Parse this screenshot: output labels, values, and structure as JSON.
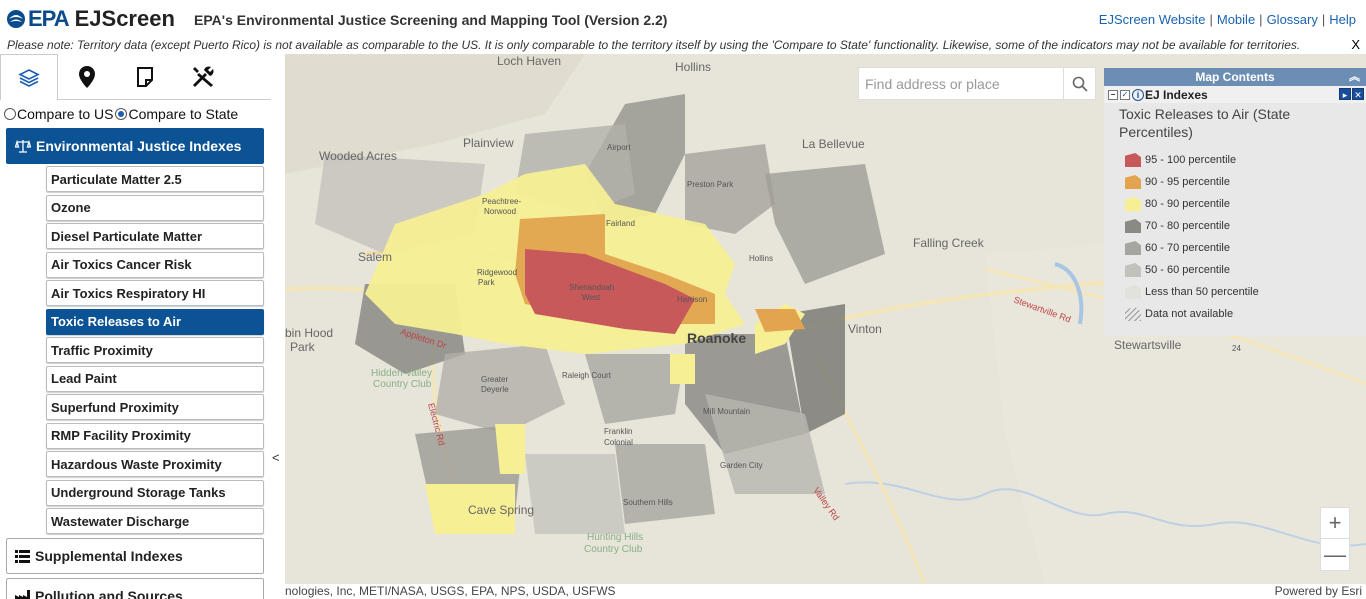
{
  "header": {
    "logo_text": "EPA",
    "app_name": "EJScreen",
    "subtitle": "EPA's Environmental Justice Screening and Mapping Tool (Version 2.2)",
    "links": [
      "EJScreen Website",
      "Mobile",
      "Glossary",
      "Help"
    ]
  },
  "notice": {
    "text": "Please note: Territory data (except Puerto Rico) is not available as comparable to the US. It is only comparable to the territory itself by using the 'Compare to State' functionality. Likewise, some of the indicators may not be available for territories.",
    "close": "X"
  },
  "tabs": [
    "layers-icon",
    "location-pin-icon",
    "report-icon",
    "tools-icon"
  ],
  "compare": {
    "us_label": "Compare to US",
    "state_label": "Compare to State",
    "selected": "state"
  },
  "groups": {
    "ej": "Environmental Justice Indexes",
    "supplemental": "Supplemental Indexes",
    "pollution": "Pollution and Sources"
  },
  "ej_items": [
    "Particulate Matter 2.5",
    "Ozone",
    "Diesel Particulate Matter",
    "Air Toxics Cancer Risk",
    "Air Toxics Respiratory HI",
    "Toxic Releases to Air",
    "Traffic Proximity",
    "Lead Paint",
    "Superfund Proximity",
    "RMP Facility Proximity",
    "Hazardous Waste Proximity",
    "Underground Storage Tanks",
    "Wastewater Discharge"
  ],
  "active_item": "Toxic Releases to Air",
  "collapse_glyph": "<",
  "search": {
    "placeholder": "Find address or place"
  },
  "map_contents": {
    "title": "Map Contents",
    "layer": "EJ Indexes",
    "sublayer": "Toxic Releases to Air (State Percentiles)",
    "legend": [
      {
        "label": "95 - 100 percentile",
        "color": "#c8595a"
      },
      {
        "label": "90 - 95 percentile",
        "color": "#e2a44e"
      },
      {
        "label": "80 - 90 percentile",
        "color": "#f6ef94"
      },
      {
        "label": "70 - 80 percentile",
        "color": "#8a8a84"
      },
      {
        "label": "60 - 70 percentile",
        "color": "#a6a6a0"
      },
      {
        "label": "50 - 60 percentile",
        "color": "#c2c2bc"
      },
      {
        "label": "Less than 50 percentile",
        "color": "#e2e2dc"
      },
      {
        "label": "Data not available",
        "color": "hatch"
      }
    ]
  },
  "map_labels": {
    "loch_haven": "Loch Haven",
    "hollins_n": "Hollins",
    "plainview": "Plainview",
    "airport": "Airport",
    "la_bellevue": "La Bellevue",
    "wooded_acres": "Wooded Acres",
    "preston_park": "Preston Park",
    "peachtree": "Peachtree-",
    "norwood": "Norwood",
    "fairland": "Fairland",
    "falling_creek": "Falling Creek",
    "salem": "Salem",
    "ridgewood": "Ridgewood",
    "park": "Park",
    "shenandoah": "Shenandoah",
    "west": "West",
    "hollins_e": "Hollins",
    "harrison": "Harrison",
    "roanoke": "Roanoke",
    "vinton": "Vinton",
    "stewartsville": "Stewartsville",
    "robin_hood": "bin Hood",
    "robin_park": "Park",
    "appleton": "Appleton Dr",
    "hidden_valley": "Hidden Valley",
    "country_club": "Country Club",
    "greater": "Greater",
    "deyerle": "Deyerle",
    "raleigh_court": "Raleigh Court",
    "mill_mountain": "Mill Mountain",
    "franklin": "Franklin",
    "colonial": "Colonial",
    "garden_city": "Garden City",
    "electric_rd": "Electric Rd",
    "cave_spring": "Cave Spring",
    "southern_hills": "Southern Hills",
    "hunting_hills": "Hunting Hills",
    "hunting_cc": "Country Club",
    "stewartville_rd": "Stewartville Rd",
    "route_24": "24",
    "valley_rd": "Valley Rd"
  },
  "zoom": {
    "in": "+",
    "out": "—"
  },
  "attribution": {
    "left": "nologies, Inc, METI/NASA, USGS, EPA, NPS, USDA, USFWS",
    "right": "Powered by Esri"
  }
}
